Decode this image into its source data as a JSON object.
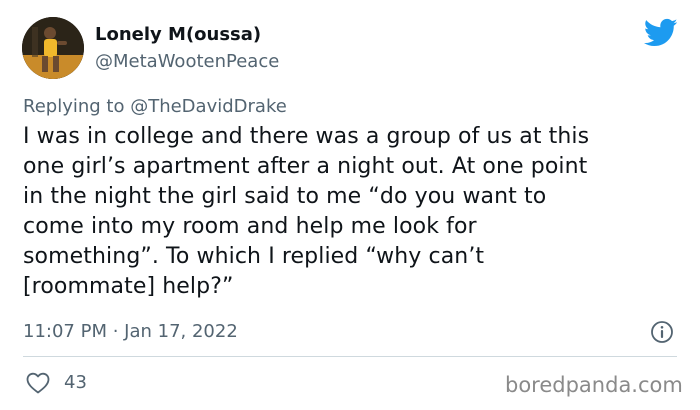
{
  "tweet": {
    "author": {
      "display_name": "Lonely M(oussa)",
      "handle": "@MetaWootenPeace"
    },
    "replying_to": {
      "prefix": "Replying to ",
      "mention": "@TheDavidDrake"
    },
    "text_lines": [
      "I was in college and there was a group of us at this",
      "one girl’s apartment after a night out. At one point",
      "in the night the girl said to me “do you want to",
      "come into my room and help me look for",
      "something”. To which I replied “why can’t",
      "[roommate] help?”"
    ],
    "timestamp": "11:07 PM · Jan 17, 2022",
    "likes": "43"
  },
  "icons": {
    "brand": "twitter-bird-icon",
    "info": "info-icon",
    "like": "heart-icon"
  },
  "colors": {
    "twitter_blue": "#1d9bf0",
    "text_primary": "#0f1419",
    "text_secondary": "#536471",
    "divider": "#cfd9de",
    "watermark": "#8a8a8a"
  },
  "watermark": "boredpanda.com"
}
